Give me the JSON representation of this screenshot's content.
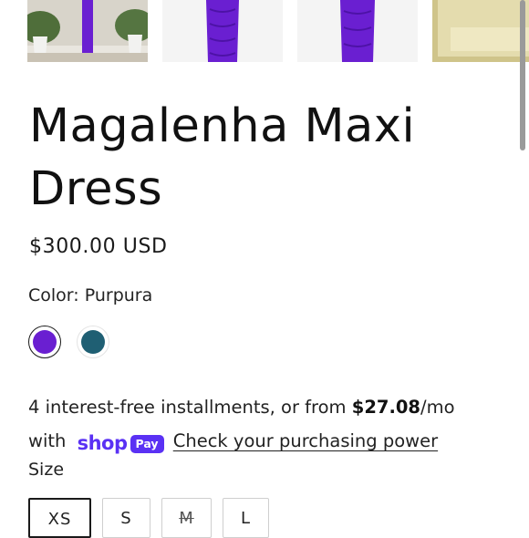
{
  "product": {
    "title": "Magalenha Maxi Dress",
    "price": "$300.00 USD",
    "color_label": "Color: Purpura",
    "colors": [
      {
        "name": "Purpura",
        "hex": "#6a1fd1",
        "selected": true
      },
      {
        "name": "Teal",
        "hex": "#1f5f73",
        "selected": false
      }
    ],
    "installments": {
      "prefix": "4 interest-free installments, or from ",
      "amount": "$27.08",
      "suffix": "/mo",
      "with": "with",
      "shop_word": "shop",
      "pay_word": "Pay",
      "link": "Check your purchasing power"
    },
    "size_label": "Size",
    "sizes": [
      {
        "label": "XS",
        "selected": true,
        "sold_out": false
      },
      {
        "label": "S",
        "selected": false,
        "sold_out": false
      },
      {
        "label": "M",
        "selected": false,
        "sold_out": true
      },
      {
        "label": "L",
        "selected": false,
        "sold_out": false
      }
    ]
  },
  "gallery": {
    "thumbnails": [
      {
        "name": "thumb-model-outdoor",
        "dress_color": "#6a1fd1"
      },
      {
        "name": "thumb-dress-front",
        "dress_color": "#6a1fd1"
      },
      {
        "name": "thumb-dress-back",
        "dress_color": "#6a1fd1"
      },
      {
        "name": "thumb-fabric-detail",
        "dress_color": "#cfc48a"
      }
    ]
  },
  "colors": {
    "text": "#1a1a1a",
    "shop_pay_brand": "#5a31f4",
    "accent_purple": "#6a1fd1"
  }
}
